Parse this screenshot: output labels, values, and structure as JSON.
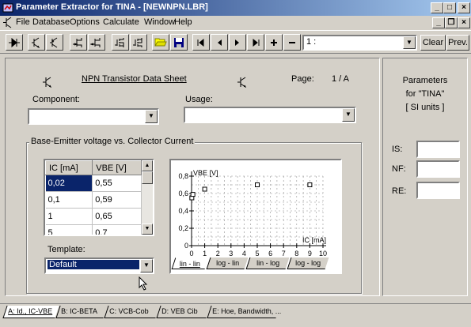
{
  "window": {
    "title": "Parameter Extractor for TINA - [NEWNPN.LBR]",
    "min": "_",
    "max": "□",
    "close": "×"
  },
  "menu": {
    "items": [
      "File",
      "Database",
      "Options",
      "Calculate",
      "Window",
      "Help"
    ]
  },
  "mdi": {
    "min": "_",
    "restore": "❐",
    "close": "×"
  },
  "toolbar": {
    "record_select": "1 :",
    "clear": "Clear",
    "prev": "Prev."
  },
  "sheet": {
    "title": "NPN Transistor Data Sheet",
    "page_label": "Page:",
    "page_value": "1 / A",
    "component_label": "Component:",
    "component_value": "",
    "usage_label": "Usage:",
    "usage_value": ""
  },
  "group": {
    "label": "Base-Emitter voltage vs. Collector Current",
    "columns": [
      "IC [mA]",
      "VBE [V]"
    ],
    "rows": [
      [
        "0,02",
        "0,55"
      ],
      [
        "0,1",
        "0,59"
      ],
      [
        "1",
        "0,65"
      ],
      [
        "5",
        "0,7"
      ]
    ],
    "template_label": "Template:",
    "template_value": "Default"
  },
  "chart_data": {
    "type": "scatter",
    "xlabel": "IC [mA]",
    "ylabel": "VBE [V]",
    "xlim": [
      0,
      10
    ],
    "ylim": [
      0,
      0.8
    ],
    "x_ticks": [
      "0",
      "1",
      "2",
      "3",
      "4",
      "5",
      "6",
      "7",
      "8",
      "9",
      "10"
    ],
    "y_ticks": [
      "0",
      "0,2",
      "0,4",
      "0,6",
      "0,8"
    ],
    "grid": true,
    "points": [
      {
        "x": 0.02,
        "y": 0.55
      },
      {
        "x": 0.1,
        "y": 0.59
      },
      {
        "x": 1,
        "y": 0.65
      },
      {
        "x": 5,
        "y": 0.7
      },
      {
        "x": 9,
        "y": 0.7
      }
    ],
    "tabs": [
      "lin - lin",
      "log - lin",
      "lin - log",
      "log - log"
    ]
  },
  "params": {
    "heading": [
      "Parameters",
      "for \"TINA\"",
      "[ SI units ]"
    ],
    "fields": [
      {
        "label": "IS:",
        "value": ""
      },
      {
        "label": "NF:",
        "value": ""
      },
      {
        "label": "RE:",
        "value": ""
      }
    ]
  },
  "bottom_tabs": [
    "A: Id., IC-VBE",
    "B: IC-BETA",
    "C: VCB-Cob",
    "D: VEB Cib",
    "E: Hoe, Bandwidth, ..."
  ]
}
